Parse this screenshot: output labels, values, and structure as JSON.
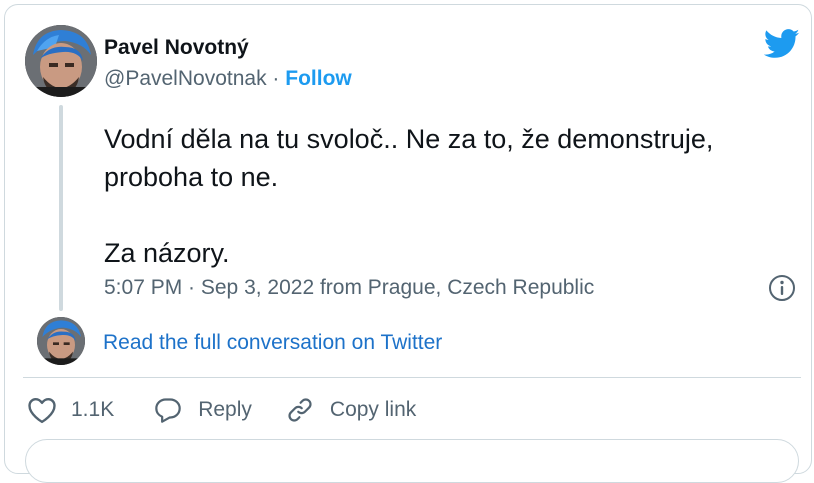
{
  "author": {
    "name": "Pavel Novotný",
    "handle": "@PavelNovotnak",
    "separator": "·",
    "follow_label": "Follow"
  },
  "tweet": {
    "lines": [
      "Vodní děla na tu svoloč.. Ne za to, že demonstruje,",
      "proboha to ne.",
      "Za názory."
    ],
    "meta": "5:07 PM · Sep 3, 2022 from Prague, Czech Republic"
  },
  "conversation_link": "Read the full conversation on Twitter",
  "actions": {
    "like_count": "1.1K",
    "reply_label": "Reply",
    "copy_link_label": "Copy link"
  },
  "icons": {
    "brand": "twitter-bird-icon",
    "info": "info-icon",
    "like": "heart-icon",
    "reply": "reply-bubble-icon",
    "copy_link": "link-icon"
  },
  "colors": {
    "accent": "#1d9bf0",
    "link": "#1d72c9",
    "text": "#0f1419",
    "secondary": "#536471",
    "border": "#cfd9de"
  }
}
